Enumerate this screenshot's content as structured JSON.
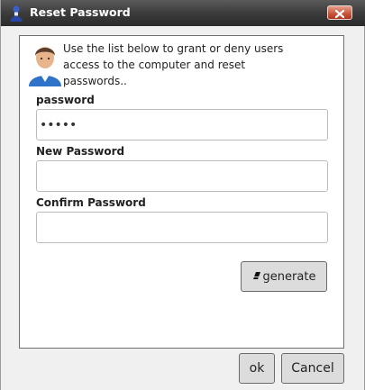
{
  "window": {
    "title": "Reset Password"
  },
  "intro_text": "Use the list below to grant or deny users access to the computer and reset passwords..",
  "fields": {
    "password": {
      "label": "password",
      "value": "•••••"
    },
    "new_password": {
      "label": "New Password",
      "value": ""
    },
    "confirm_password": {
      "label": "Confirm Password",
      "value": ""
    }
  },
  "buttons": {
    "generate": "generate",
    "ok": "ok",
    "cancel": "Cancel"
  },
  "icons": {
    "title": "user-icon",
    "intro": "user-icon",
    "close": "close-icon",
    "generate": "eraser-icon"
  }
}
